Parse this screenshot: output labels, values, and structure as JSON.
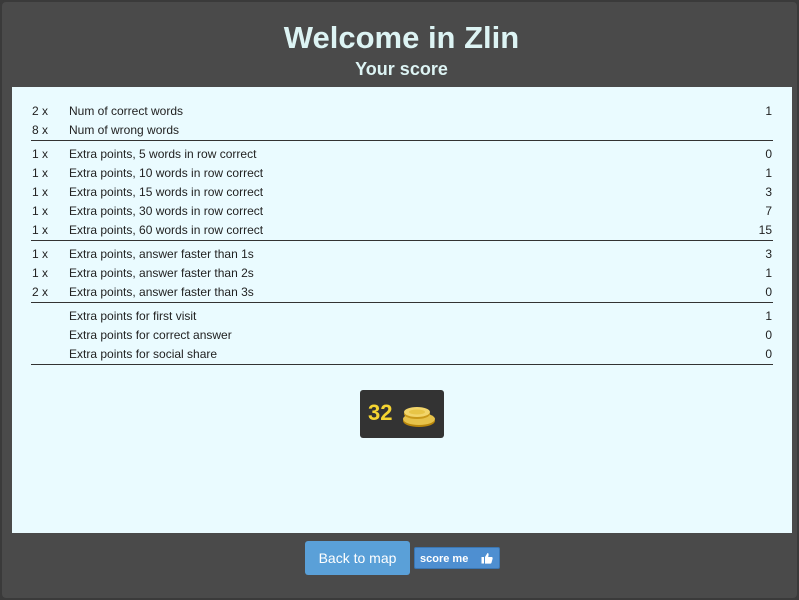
{
  "header": {
    "title": "Welcome in Zlin",
    "subtitle": "Your score"
  },
  "groups": [
    [
      {
        "mult": "2 x",
        "label": "Num of correct words",
        "value": "1"
      },
      {
        "mult": "8 x",
        "label": "Num of wrong words",
        "value": ""
      }
    ],
    [
      {
        "mult": "1 x",
        "label": "Extra points, 5 words in row correct",
        "value": "0"
      },
      {
        "mult": "1 x",
        "label": "Extra points, 10 words in row correct",
        "value": "1"
      },
      {
        "mult": "1 x",
        "label": "Extra points, 15 words in row correct",
        "value": "3"
      },
      {
        "mult": "1 x",
        "label": "Extra points, 30 words in row correct",
        "value": "7"
      },
      {
        "mult": "1 x",
        "label": "Extra points, 60 words in row correct",
        "value": "15"
      }
    ],
    [
      {
        "mult": "1 x",
        "label": "Extra points, answer faster than 1s",
        "value": "3"
      },
      {
        "mult": "1 x",
        "label": "Extra points, answer faster than 2s",
        "value": "1"
      },
      {
        "mult": "2 x",
        "label": "Extra points, answer faster than 3s",
        "value": "0"
      }
    ],
    [
      {
        "mult": "",
        "label": "Extra points for first visit",
        "value": "1"
      },
      {
        "mult": "",
        "label": "Extra points for correct answer",
        "value": "0"
      },
      {
        "mult": "",
        "label": "Extra points for social share",
        "value": "0"
      }
    ]
  ],
  "total": {
    "value": "32",
    "icon": "coins-icon"
  },
  "footer": {
    "back_label": "Back to map",
    "score_label": "score me",
    "score_icon": "thumbs-up-icon"
  },
  "colors": {
    "background": "#4a4a4a",
    "panel": "#eafbff",
    "title": "#ddf4f4",
    "total_text": "#f5d431",
    "button": "#5aa0d8"
  }
}
